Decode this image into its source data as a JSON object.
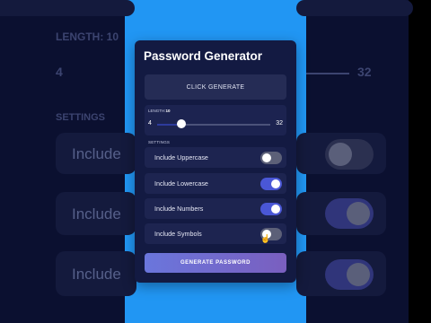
{
  "app": {
    "title": "Password Generator",
    "password_display": "CLICK GENERATE"
  },
  "length": {
    "label": "LENGTH:",
    "value": "10",
    "min": "4",
    "max": "32",
    "current": 10
  },
  "settings": {
    "label": "SETTINGS",
    "options": [
      {
        "label": "Include Uppercase",
        "enabled": false
      },
      {
        "label": "Include Lowercase",
        "enabled": true
      },
      {
        "label": "Include Numbers",
        "enabled": true
      },
      {
        "label": "Include Symbols",
        "enabled": false
      }
    ]
  },
  "actions": {
    "generate_label": "GENERATE PASSWORD"
  },
  "background": {
    "length_label": "LENGTH:",
    "length_value": "10",
    "min": "4",
    "max": "32",
    "settings_label": "SETTINGS",
    "include_text": "Include"
  },
  "colors": {
    "card": "#131a42",
    "toggle_on": "#4a57d6",
    "toggle_off": "#5c6078",
    "side_blue": "#2196f3"
  }
}
